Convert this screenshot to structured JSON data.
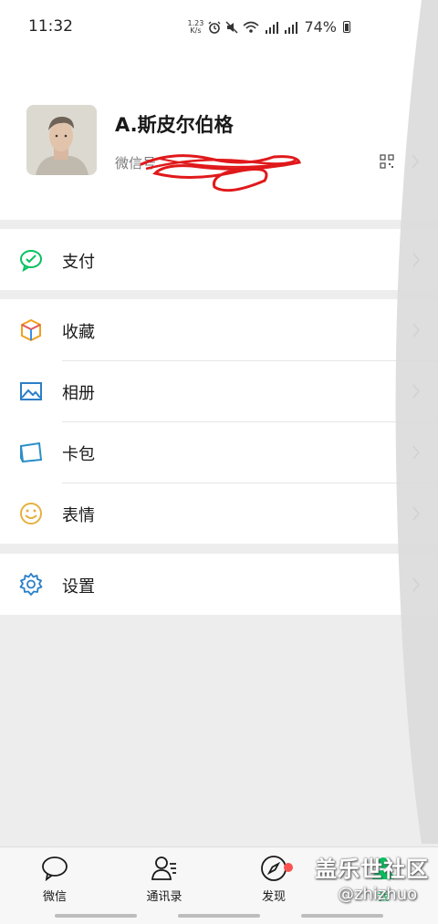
{
  "status_bar": {
    "time": "11:32",
    "net_speed_value": "1.23",
    "net_speed_unit": "K/s",
    "battery": "74%"
  },
  "profile": {
    "name": "A.斯皮尔伯格",
    "wechat_id_label": "微信号"
  },
  "menu": {
    "pay": {
      "label": "支付",
      "icon": "wechat-pay-icon"
    },
    "favorites": {
      "label": "收藏",
      "icon": "cube-icon"
    },
    "album": {
      "label": "相册",
      "icon": "picture-icon"
    },
    "cards": {
      "label": "卡包",
      "icon": "wallet-icon"
    },
    "stickers": {
      "label": "表情",
      "icon": "smiley-icon"
    },
    "settings": {
      "label": "设置",
      "icon": "gear-icon"
    }
  },
  "tabs": [
    {
      "label": "微信",
      "icon": "chat-bubble-icon"
    },
    {
      "label": "通讯录",
      "icon": "contacts-icon"
    },
    {
      "label": "发现",
      "icon": "compass-icon"
    },
    {
      "label": "我",
      "icon": "person-icon",
      "active": true
    }
  ],
  "watermark": {
    "title": "盖乐世社区",
    "handle": "@zhizhuo"
  },
  "colors": {
    "accent_green": "#07c160",
    "badge_red": "#fa5151",
    "background": "#ededed",
    "scribble_red": "#e0191b"
  }
}
